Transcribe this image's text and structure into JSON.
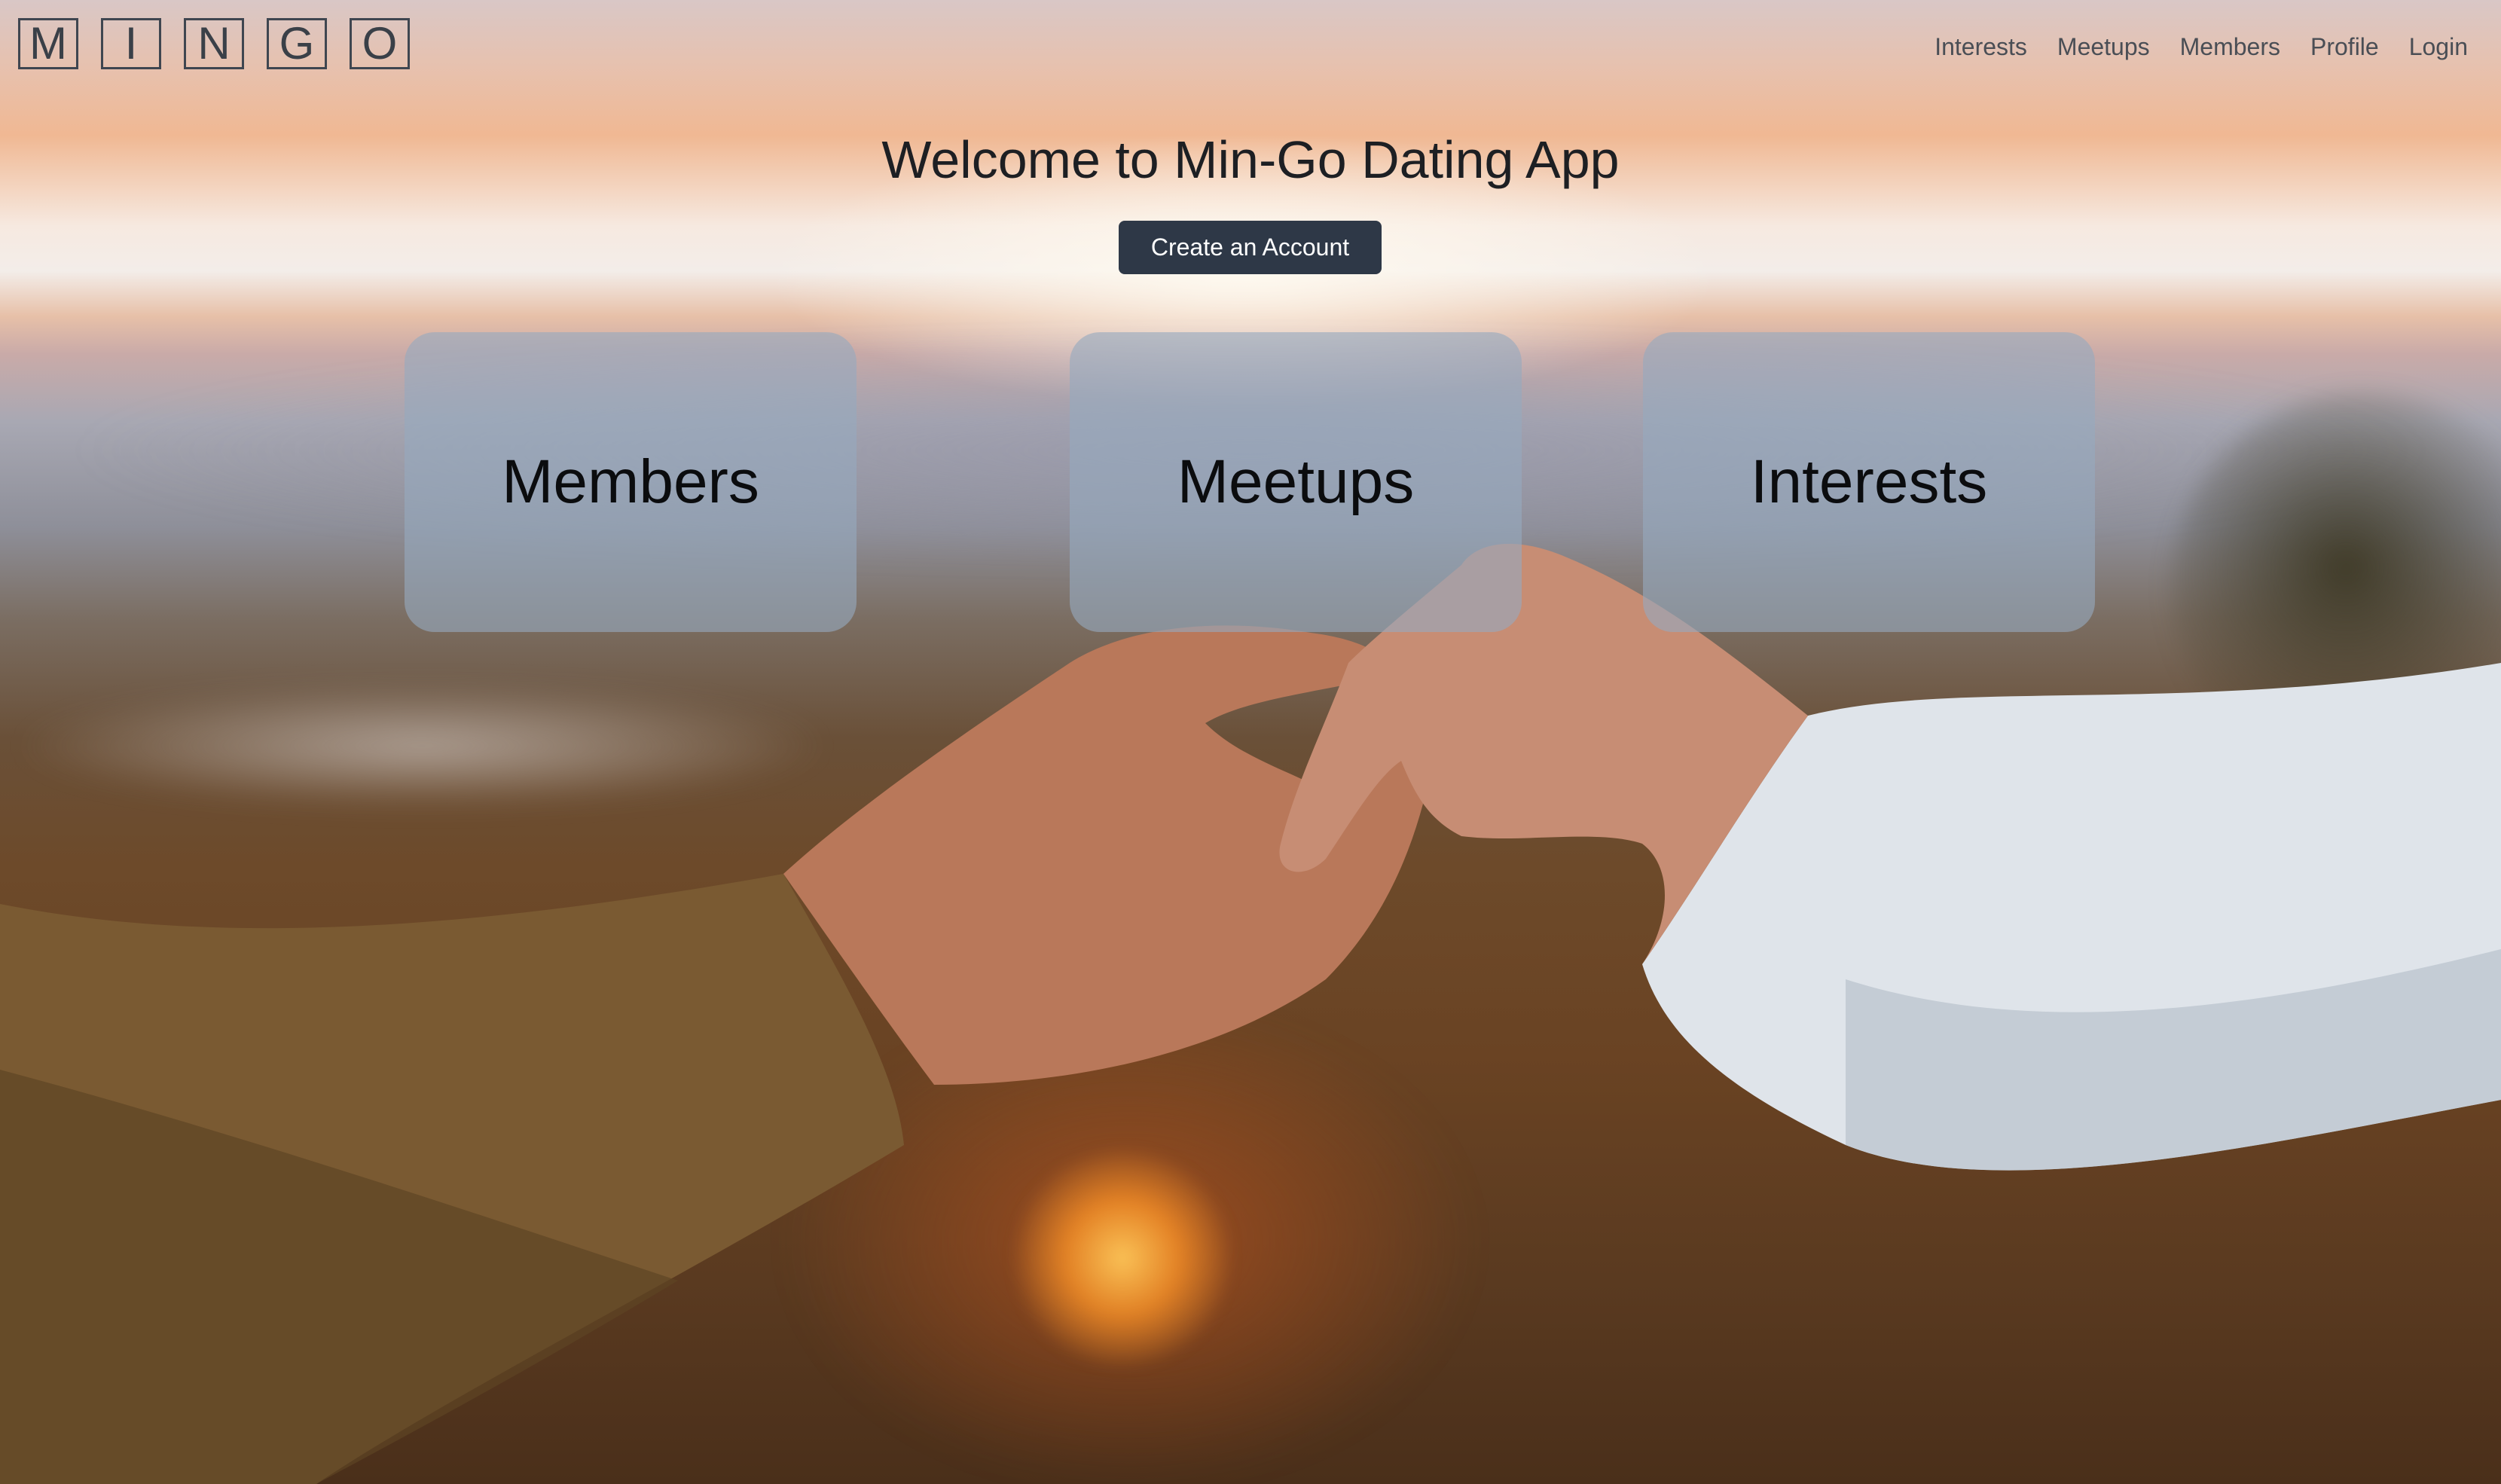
{
  "logo": {
    "letters": [
      "M",
      "I",
      "N",
      "G",
      "O"
    ]
  },
  "nav": {
    "items": [
      "Interests",
      "Meetups",
      "Members",
      "Profile",
      "Login"
    ]
  },
  "hero": {
    "title": "Welcome to Min-Go Dating App",
    "cta_label": "Create an Account"
  },
  "cards": [
    {
      "label": "Members"
    },
    {
      "label": "Meetups"
    },
    {
      "label": "Interests"
    }
  ],
  "colors": {
    "cta_background": "#2e3847",
    "card_background": "#96aabe",
    "text_dark": "#1d1f23"
  }
}
